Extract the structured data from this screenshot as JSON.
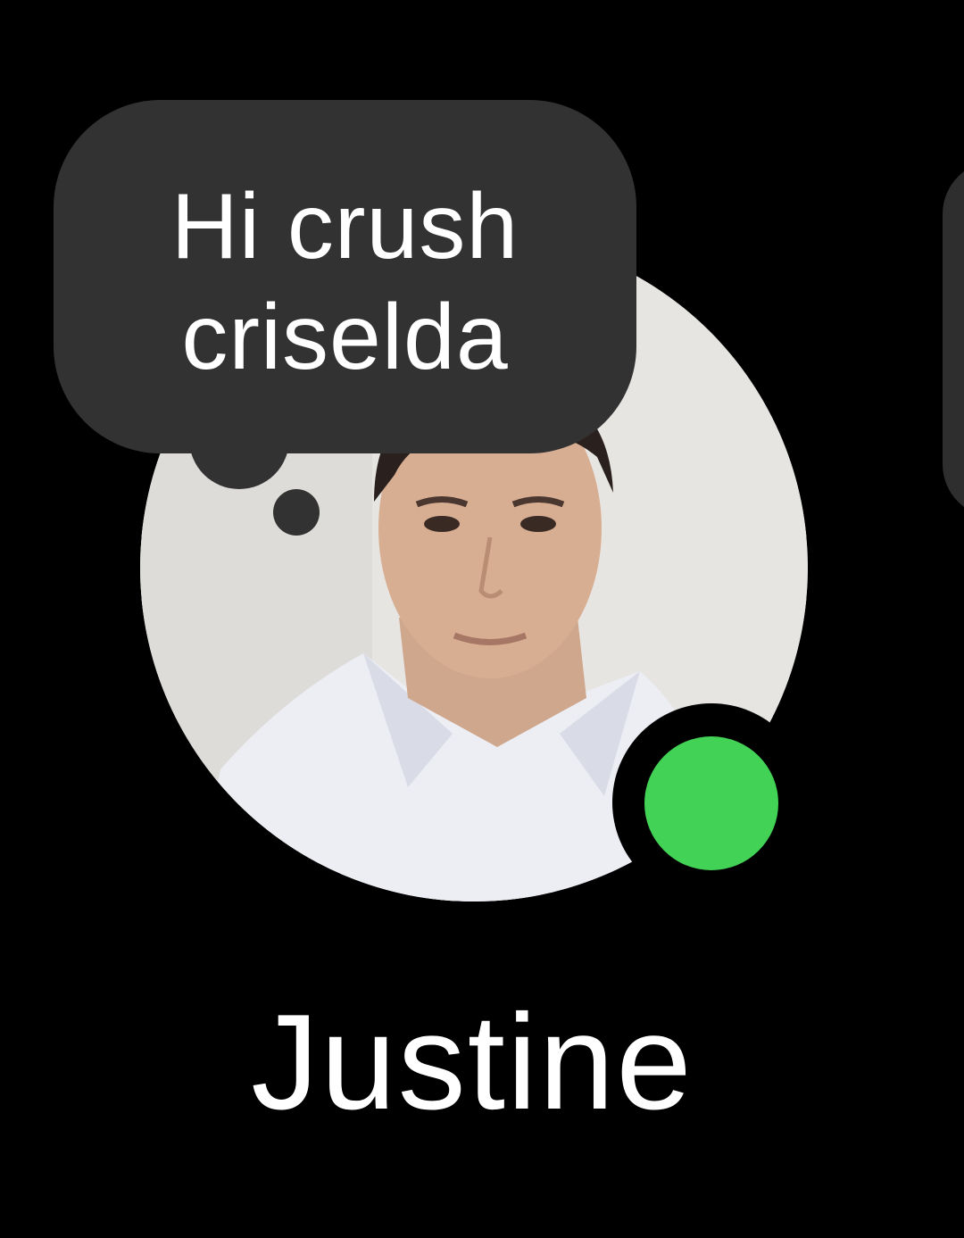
{
  "contact": {
    "name": "Justine",
    "note": "Hi crush criselda",
    "online": true
  },
  "colors": {
    "background": "#000000",
    "bubble": "#323232",
    "online": "#42d255",
    "text": "#ffffff"
  },
  "icons": {
    "presence": "online-status-dot"
  }
}
